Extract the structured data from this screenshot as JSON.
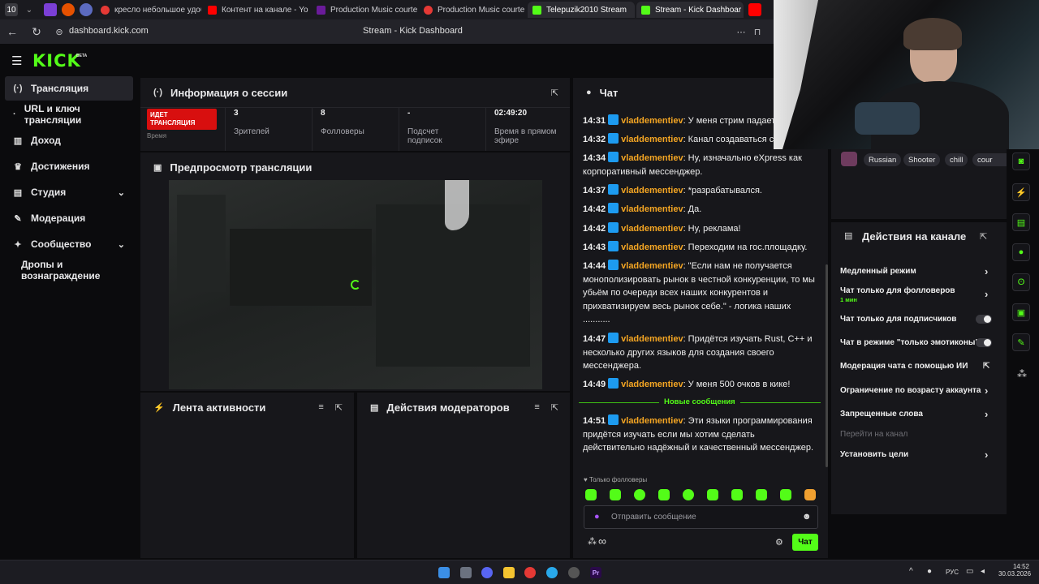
{
  "browser": {
    "tab_count": "10",
    "tabs": [
      {
        "label": "кресло небольшое удобн",
        "favicon_color": "#e53935"
      },
      {
        "label": "Контент на канале - YouT",
        "favicon_color": "#ff0000"
      },
      {
        "label": "Production Music courtes",
        "favicon_color": "#6a1b9a"
      },
      {
        "label": "Production Music courtes",
        "favicon_color": "#e53935"
      },
      {
        "label": "Telepuzik2010 Stream",
        "favicon_color": "#53fc18"
      },
      {
        "label": "Stream - Kick Dashboar",
        "favicon_color": "#53fc18"
      }
    ],
    "url": "dashboard.kick.com",
    "page_title": "Stream - Kick Dashboard"
  },
  "brand": {
    "logo": "KICK",
    "beta": "BETA",
    "accent": "#53fc18"
  },
  "sidebar": {
    "items": [
      {
        "label": "Трансляция",
        "icon": "broadcast-icon"
      },
      {
        "label": "URL и ключ трансляции",
        "icon": ""
      },
      {
        "label": "Доход",
        "icon": "chart-icon"
      },
      {
        "label": "Достижения",
        "icon": "trophy-icon"
      },
      {
        "label": "Студия",
        "icon": "studio-icon"
      },
      {
        "label": "Модерация",
        "icon": "wrench-icon"
      },
      {
        "label": "Сообщество",
        "icon": "community-icon"
      },
      {
        "label": "Дропы и вознаграждение",
        "icon": ""
      }
    ]
  },
  "session": {
    "title": "Информация о сессии",
    "live_badge": "ИДЕТ ТРАНСЛЯЦИЯ",
    "live_sub": "Время",
    "stats": [
      {
        "value": "3",
        "label": "Зрителей"
      },
      {
        "value": "8",
        "label": "Фолловеры"
      },
      {
        "value": "-",
        "label": "Подсчет подписок"
      },
      {
        "value": "02:49:20",
        "label": "Время в прямом эфире"
      }
    ]
  },
  "preview": {
    "title": "Предпросмотр трансляции"
  },
  "activity": {
    "title": "Лента активности"
  },
  "mod_actions": {
    "title": "Действия модераторов"
  },
  "chat": {
    "title": "Чат",
    "messages": [
      {
        "time": "14:31",
        "user": "vladdementiev",
        "text": ": У меня стрим падает"
      },
      {
        "time": "14:32",
        "user": "vladdementiev",
        "text": ": Канал создаваться с"
      },
      {
        "time": "14:34",
        "user": "vladdementiev",
        "text": ": Ну, изначально eXpress как корпоративный мессенджер."
      },
      {
        "time": "14:37",
        "user": "vladdementiev",
        "text": ": *разрабатывался."
      },
      {
        "time": "14:42",
        "user": "vladdementiev",
        "text": ": Да."
      },
      {
        "time": "14:42",
        "user": "vladdementiev",
        "text": ": Ну, реклама!"
      },
      {
        "time": "14:43",
        "user": "vladdementiev",
        "text": ": Переходим на гос.площадку."
      },
      {
        "time": "14:44",
        "user": "vladdementiev",
        "text": ": \"Если нам не получается монополизировать рынок в честной конкуренции, то мы убьём по очереди всех наших конкурентов и прихватизируем весь рынок себе.\" - логика наших ..........."
      },
      {
        "time": "14:47",
        "user": "vladdementiev",
        "text": ": Придётся изучать Rust, C++ и несколько других языков для создания своего мессенджера."
      },
      {
        "time": "14:49",
        "user": "vladdementiev",
        "text": ": У меня 500 очков в кике!"
      },
      {
        "time": "14:51",
        "user": "vladdementiev",
        "text": ": Эти языки программирования придётся изучать если мы хотим сделать действительно надёжный и качественный мессенджер."
      }
    ],
    "new_messages": "Новые сообщения",
    "followers_only": "Только фолловеры",
    "input_placeholder": "Отправить сообщение",
    "send_label": "Чат",
    "infinity": "∞"
  },
  "tags": [
    "Russian",
    "Shooter",
    "chill",
    "cour"
  ],
  "channel_actions": {
    "title": "Действия на канале",
    "items": [
      {
        "label": "Медленный режим",
        "control": "arrow"
      },
      {
        "label": "Чат только для фолловеров",
        "sub": "1 мин",
        "control": "arrow"
      },
      {
        "label": "Чат только для подписчиков",
        "control": "toggle"
      },
      {
        "label": "Чат в режиме \"только эмотиконы\"",
        "control": "toggle"
      },
      {
        "label": "Модерация чата с помощью ИИ",
        "control": "external"
      },
      {
        "label": "Ограничение по возрасту аккаунта",
        "control": "arrow"
      },
      {
        "label": "Запрещенные слова",
        "control": "arrow"
      },
      {
        "label": "Перейти на канал",
        "control": "none"
      },
      {
        "label": "Установить цели",
        "control": "arrow"
      }
    ]
  },
  "taskbar": {
    "lang": "РУС",
    "time": "14:52",
    "date": "30.03.2026"
  }
}
